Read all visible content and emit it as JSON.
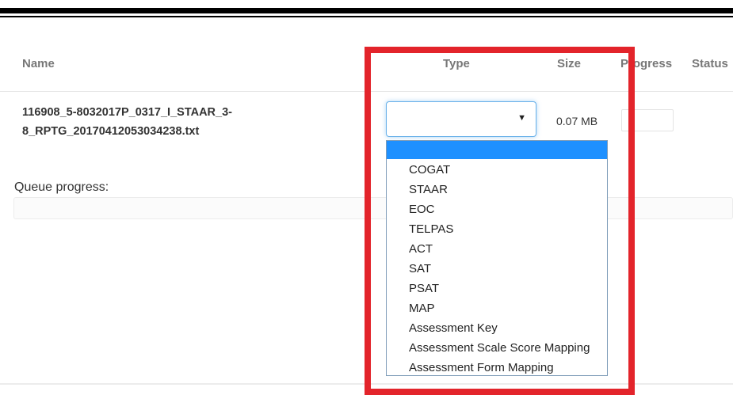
{
  "table": {
    "headers": {
      "name": "Name",
      "type": "Type",
      "size": "Size",
      "progress": "Progress",
      "status": "Status"
    },
    "row": {
      "filename_line1": "116908_5-8032017P_0317_I_STAAR_3-",
      "filename_line2": "8_RPTG_20170412053034238.txt",
      "type_selected": "",
      "size": "0.07 MB",
      "progress_value": ""
    }
  },
  "queue": {
    "label": "Queue progress:"
  },
  "type_dropdown": {
    "highlighted_option": "",
    "options": [
      "COGAT",
      "STAAR",
      "EOC",
      "TELPAS",
      "ACT",
      "SAT",
      "PSAT",
      "MAP",
      "Assessment Key",
      "Assessment Scale Score Mapping",
      "Assessment Form Mapping"
    ]
  },
  "icons": {
    "select_arrow": "caret-down-icon"
  },
  "colors": {
    "highlight_frame": "#e3242b",
    "dropdown_highlight": "#1e90ff",
    "focus_border": "#66afe9"
  }
}
